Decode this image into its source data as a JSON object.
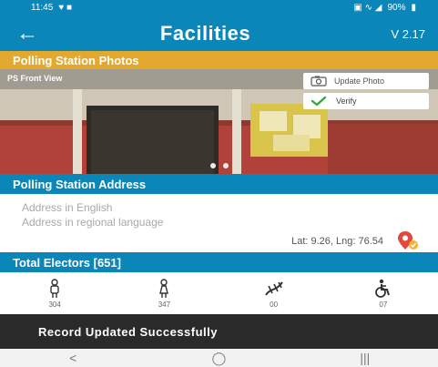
{
  "status_bar": {
    "time": "11:45",
    "battery": "90%"
  },
  "app_bar": {
    "title": "Facilities",
    "version": "V 2.17"
  },
  "photos_section": {
    "header": "Polling Station Photos",
    "caption": "PS Front View",
    "update_photo_label": "Update Photo",
    "verify_label": "Verify",
    "dots": 2
  },
  "address_section": {
    "header": "Polling Station Address",
    "address_english": "Address in English",
    "address_regional": "Address in regional language",
    "lat_lng": "Lat: 9.26, Lng: 76.54"
  },
  "electors_section": {
    "header": "Total Electors [651]",
    "categories": [
      {
        "icon": "male-icon",
        "count": "304"
      },
      {
        "icon": "female-icon",
        "count": "347"
      },
      {
        "icon": "third-gender-icon",
        "count": "00"
      },
      {
        "icon": "wheelchair-icon",
        "count": "07"
      }
    ]
  },
  "toast": {
    "message": "Record Updated Successfully"
  },
  "colors": {
    "primary": "#0b86b8",
    "accent": "#e3a92e",
    "toast": "#2a2a2a"
  }
}
